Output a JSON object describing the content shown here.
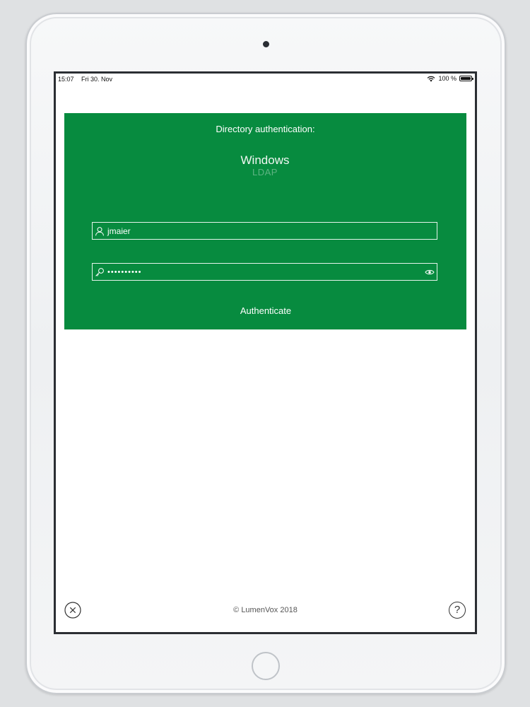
{
  "status_bar": {
    "time": "15:07",
    "date": "Fri 30. Nov",
    "battery": "100 %",
    "wifi_icon": "wifi-icon",
    "battery_icon": "battery-icon"
  },
  "auth": {
    "heading": "Directory authentication:",
    "directory_options": [
      "Windows",
      "LDAP"
    ],
    "selected_directory": "Windows",
    "username": {
      "value": "jmaier",
      "icon": "user-icon"
    },
    "password": {
      "value": "••••••••••",
      "icon": "key-icon",
      "toggle_icon": "eye-icon"
    },
    "submit_label": "Authenticate",
    "panel_color": "#078b3f"
  },
  "footer": {
    "close_icon": "close-circle-icon",
    "help_label": "?",
    "copyright": "© LumenVox 2018"
  }
}
